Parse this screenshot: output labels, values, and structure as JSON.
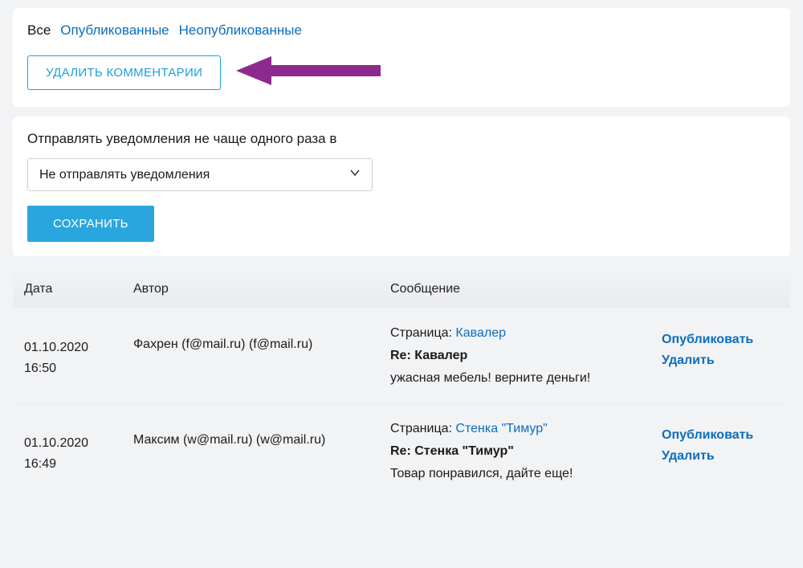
{
  "filters": {
    "all": "Все",
    "published": "Опубликованные",
    "unpublished": "Неопубликованные"
  },
  "buttons": {
    "delete_comments": "УДАЛИТЬ КОММЕНТАРИИ",
    "save": "СОХРАНИТЬ"
  },
  "notify": {
    "label": "Отправлять уведомления не чаще одного раза в",
    "selected": "Не отправлять уведомления"
  },
  "table": {
    "headers": {
      "date": "Дата",
      "author": "Автор",
      "message": "Сообщение"
    },
    "page_label": "Страница:",
    "re_prefix": "Re:",
    "actions": {
      "publish": "Опубликовать",
      "delete": "Удалить"
    },
    "rows": [
      {
        "date": "01.10.2020",
        "time": "16:50",
        "author": "Фахрен (f@mail.ru) (f@mail.ru)",
        "page": "Кавалер",
        "subject": "Кавалер",
        "body": "ужасная мебель! верните деньги!"
      },
      {
        "date": "01.10.2020",
        "time": "16:49",
        "author": "Максим (w@mail.ru) (w@mail.ru)",
        "page": "Стенка \"Тимур\"",
        "subject": "Стенка \"Тимур\"",
        "body": "Товар понравился, дайте еще!"
      }
    ]
  }
}
